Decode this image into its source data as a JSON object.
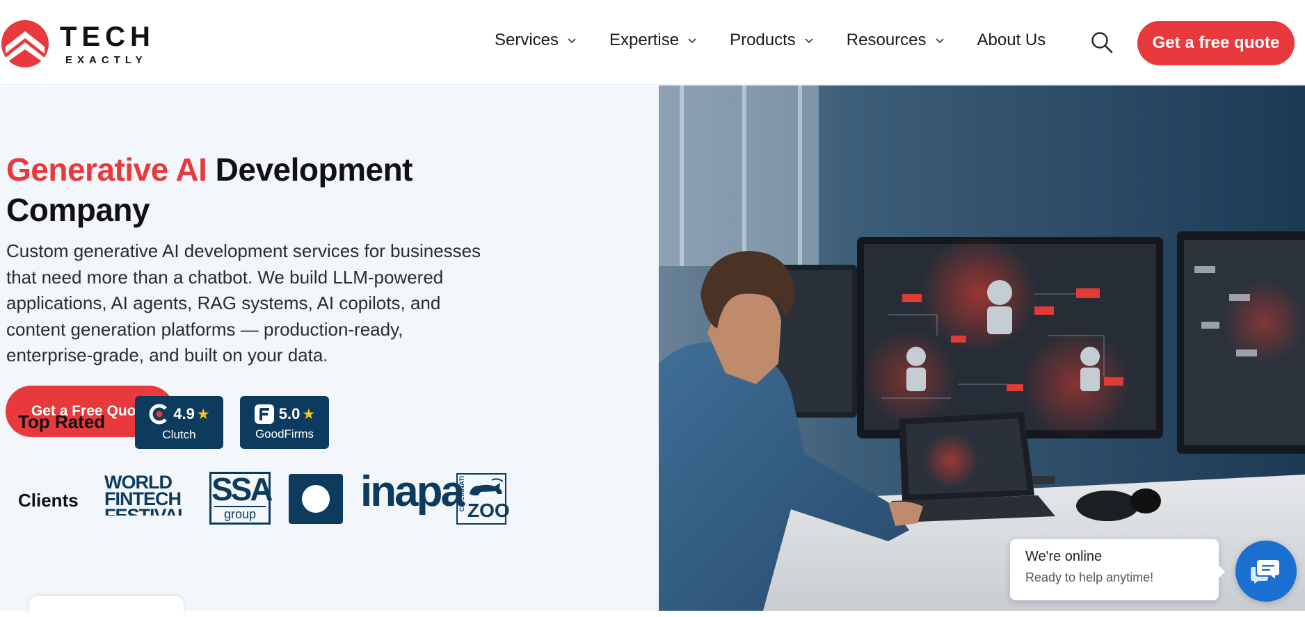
{
  "brand": {
    "line1": "TECH",
    "line2": "EXACTLY",
    "accent_color": "#e8393c",
    "navy_color": "#0c3b5e"
  },
  "nav": {
    "items": [
      {
        "label": "Services",
        "has_dropdown": true
      },
      {
        "label": "Expertise",
        "has_dropdown": true
      },
      {
        "label": "Products",
        "has_dropdown": true
      },
      {
        "label": "Resources",
        "has_dropdown": true
      },
      {
        "label": "About Us",
        "has_dropdown": false
      }
    ],
    "search_icon": "search-icon",
    "cta_label": "Get a free quote"
  },
  "hero": {
    "title_accent": "Generative AI",
    "title_rest": " Development Company",
    "description": "Custom generative AI development services for businesses that need more than a chatbot. We build LLM-powered applications, AI agents, RAG systems, AI copilots, and content generation platforms — production-ready, enterprise-grade, and built on your data.",
    "cta_label": "Get a Free Quote"
  },
  "ratings": {
    "label": "Top Rated",
    "badges": [
      {
        "score": "4.9",
        "name": "Clutch",
        "icon": "clutch-icon"
      },
      {
        "score": "5.0",
        "name": "GoodFirms",
        "icon": "goodfirms-icon"
      }
    ],
    "star": "★"
  },
  "clients": {
    "label": "Clients",
    "logos": [
      {
        "name": "world-fintech-festival",
        "text_lines": [
          "WORLD",
          "FINTECH",
          "FESTIVAL"
        ]
      },
      {
        "name": "ssa-group",
        "text_main": "SSA",
        "text_sub": "group"
      },
      {
        "name": "ring-logo"
      },
      {
        "name": "inapa",
        "text_main": "inapa"
      },
      {
        "name": "cincinnati-zoo",
        "text_side": "CINCINNATI",
        "text_main": "ZOO"
      }
    ]
  },
  "chat": {
    "status": "We're online",
    "subtitle": "Ready to help anytime!",
    "icon": "chat-icon"
  }
}
